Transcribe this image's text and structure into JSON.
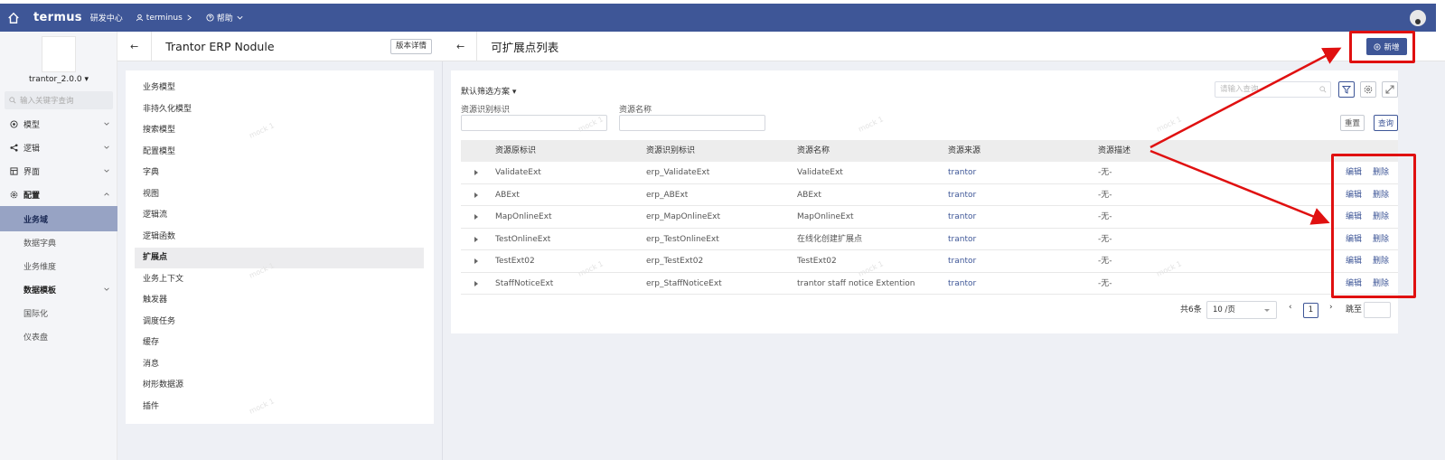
{
  "topbar": {
    "logo": "termus",
    "nav_dev": "研发中心",
    "nav_project": "terminus",
    "nav_help": "帮助"
  },
  "sidebar": {
    "version": "trantor_2.0.0",
    "search_placeholder": "输入关键字查询",
    "items": [
      {
        "label": "模型",
        "icon": "model-icon"
      },
      {
        "label": "逻辑",
        "icon": "share-icon"
      },
      {
        "label": "界面",
        "icon": "ui-icon"
      },
      {
        "label": "配置",
        "icon": "gear-icon"
      },
      {
        "label": "业务域"
      },
      {
        "label": "数据字典"
      },
      {
        "label": "业务维度"
      },
      {
        "label": "数据模板"
      },
      {
        "label": "国际化"
      },
      {
        "label": "仪表盘"
      }
    ]
  },
  "module": {
    "title": "Trantor ERP Nodule",
    "detail_button": "版本详情",
    "items": [
      "业务模型",
      "非持久化模型",
      "搜索模型",
      "配置模型",
      "字典",
      "视图",
      "逻辑流",
      "逻辑函数",
      "扩展点",
      "业务上下文",
      "触发器",
      "调度任务",
      "缓存",
      "消息",
      "树形数据源",
      "插件"
    ]
  },
  "main": {
    "title": "可扩展点列表",
    "new_button": "新增",
    "filter_scheme": "默认筛选方案",
    "filter_id_label": "资源识别标识",
    "filter_name_label": "资源名称",
    "search_placeholder": "请输入查询",
    "reset_button": "重置",
    "query_button": "查询",
    "columns": [
      "资源原标识",
      "资源识别标识",
      "资源名称",
      "资源来源",
      "资源描述"
    ],
    "rows": [
      {
        "orig": "ValidateExt",
        "id": "erp_ValidateExt",
        "name": "ValidateExt",
        "source": "trantor",
        "desc": "-无-"
      },
      {
        "orig": "ABExt",
        "id": "erp_ABExt",
        "name": "ABExt",
        "source": "trantor",
        "desc": "-无-"
      },
      {
        "orig": "MapOnlineExt",
        "id": "erp_MapOnlineExt",
        "name": "MapOnlineExt",
        "source": "trantor",
        "desc": "-无-"
      },
      {
        "orig": "TestOnlineExt",
        "id": "erp_TestOnlineExt",
        "name": "在线化创建扩展点",
        "source": "trantor",
        "desc": "-无-"
      },
      {
        "orig": "TestExt02",
        "id": "erp_TestExt02",
        "name": "TestExt02",
        "source": "trantor",
        "desc": "-无-"
      },
      {
        "orig": "StaffNoticeExt",
        "id": "erp_StaffNoticeExt",
        "name": "trantor staff notice Extention",
        "source": "trantor",
        "desc": "-无-"
      }
    ],
    "edit_label": "编辑",
    "delete_label": "删除",
    "total": "共6条",
    "page_size": "10 /页",
    "current_page": "1",
    "jump_label": "跳至"
  },
  "watermark": "mock 1",
  "colors": {
    "primary": "#3e5697",
    "annotation": "#e01010"
  }
}
